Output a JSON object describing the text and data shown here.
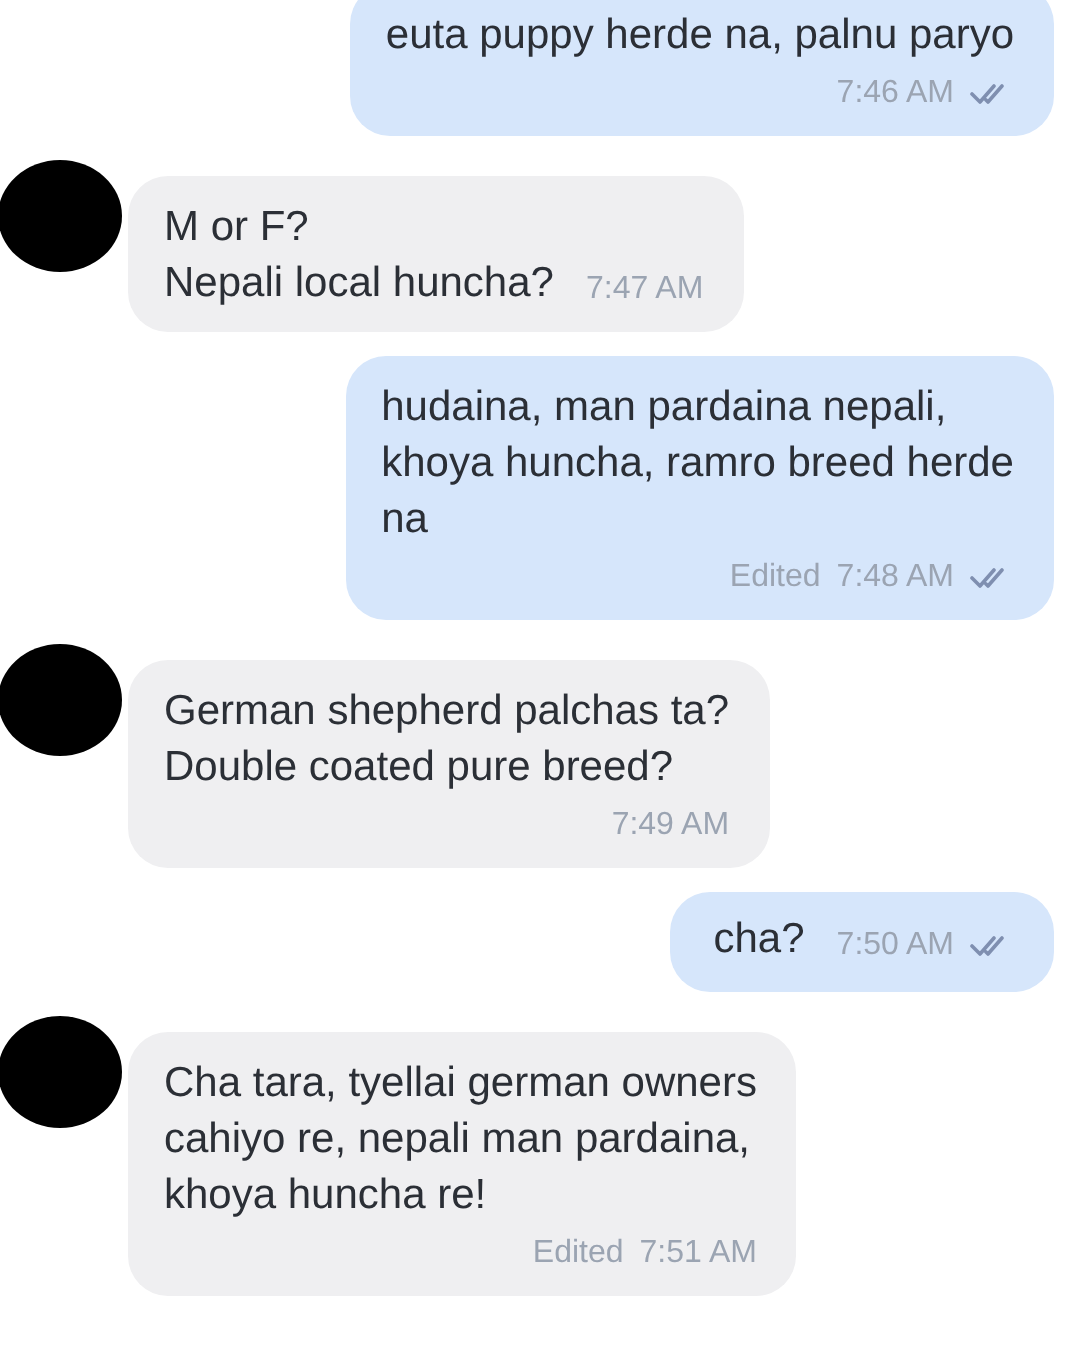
{
  "messages": [
    {
      "kind": "out",
      "time_inline": false,
      "text": "euta puppy herde na, palnu paryo",
      "time": "7:46 AM"
    },
    {
      "kind": "in",
      "time_inline": true,
      "text": "M or F?\nNepali local huncha?",
      "time": "7:47 AM"
    },
    {
      "kind": "out",
      "time_inline": false,
      "text": "hudaina, man pardaina nepali,\nkhoya huncha, ramro breed herde\nna",
      "edited_label": "Edited",
      "time": "7:48 AM"
    },
    {
      "kind": "in",
      "time_inline": false,
      "text": "German shepherd palchas ta?\nDouble coated pure breed?",
      "time": "7:49 AM"
    },
    {
      "kind": "out",
      "time_inline": true,
      "text": "cha?",
      "time": "7:50 AM"
    },
    {
      "kind": "in",
      "time_inline": false,
      "text": "Cha tara, tyellai german owners\ncahiyo re, nepali man pardaina,\nkhoya huncha re!",
      "edited_label": "Edited",
      "time": "7:51 AM"
    }
  ]
}
